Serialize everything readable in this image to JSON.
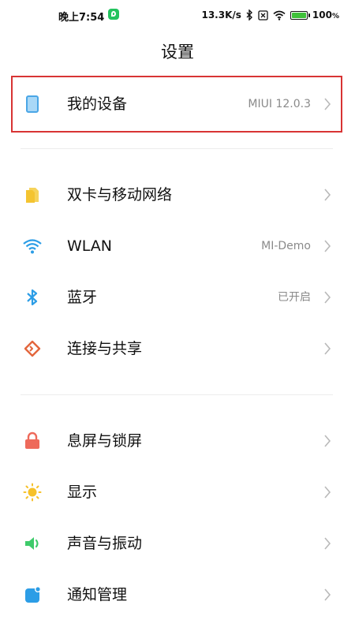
{
  "status_bar": {
    "time": "晚上7:54",
    "net_speed": "13.3K/s",
    "battery_text": "100",
    "battery_unit": "%"
  },
  "header": {
    "title": "设置"
  },
  "items": [
    {
      "label": "我的设备",
      "value": "MIUI 12.0.3",
      "icon": "device-icon",
      "color": "#4aa6e6"
    },
    {
      "label": "双卡与移动网络",
      "value": "",
      "icon": "sim-card-icon",
      "color": "#f4c430"
    },
    {
      "label": "WLAN",
      "value": "MI-Demo",
      "icon": "wifi-icon",
      "color": "#2c9de6"
    },
    {
      "label": "蓝牙",
      "value": "已开启",
      "icon": "bluetooth-icon",
      "color": "#2c9de6"
    },
    {
      "label": "连接与共享",
      "value": "",
      "icon": "share-icon",
      "color": "#e3663c"
    },
    {
      "label": "息屏与锁屏",
      "value": "",
      "icon": "lock-icon",
      "color": "#ee6a5b"
    },
    {
      "label": "显示",
      "value": "",
      "icon": "sun-icon",
      "color": "#f6c12a"
    },
    {
      "label": "声音与振动",
      "value": "",
      "icon": "speaker-icon",
      "color": "#3ecb6a"
    },
    {
      "label": "通知管理",
      "value": "",
      "icon": "notification-icon",
      "color": "#2c9de6"
    }
  ]
}
